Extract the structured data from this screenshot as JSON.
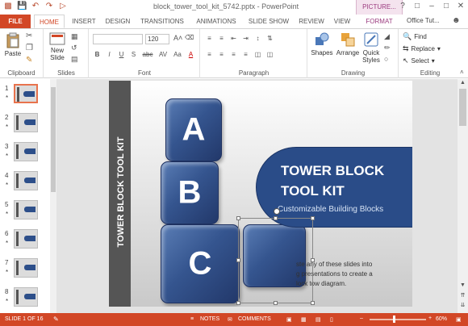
{
  "app": {
    "title": "block_tower_tool_kit_5742.pptx - PowerPoint",
    "context_tab": "PICTURE...",
    "user": "Office Tut..."
  },
  "qat": {
    "icons": [
      "powerpoint-icon",
      "save-icon",
      "undo-icon",
      "redo-icon",
      "start-slideshow-icon"
    ]
  },
  "tabs": [
    "FILE",
    "HOME",
    "INSERT",
    "DESIGN",
    "TRANSITIONS",
    "ANIMATIONS",
    "SLIDE SHOW",
    "REVIEW",
    "VIEW",
    "FORMAT"
  ],
  "active_tab": "HOME",
  "ribbon": {
    "clipboard": {
      "label": "Clipboard",
      "paste": "Paste"
    },
    "slides": {
      "label": "Slides",
      "new_slide_line1": "New",
      "new_slide_line2": "Slide"
    },
    "font": {
      "label": "Font",
      "font_size": "120",
      "format_buttons": [
        "B",
        "I",
        "U",
        "S",
        "abc",
        "AV",
        "Aa",
        "A"
      ]
    },
    "paragraph": {
      "label": "Paragraph"
    },
    "drawing": {
      "label": "Drawing",
      "shapes": "Shapes",
      "arrange": "Arrange",
      "quick_styles_line1": "Quick",
      "quick_styles_line2": "Styles"
    },
    "editing": {
      "label": "Editing",
      "find": "Find",
      "replace": "Replace",
      "select": "Select"
    }
  },
  "thumbnails": [
    {
      "num": "1",
      "star": "*"
    },
    {
      "num": "2",
      "star": "*"
    },
    {
      "num": "3",
      "star": "*"
    },
    {
      "num": "4",
      "star": "*"
    },
    {
      "num": "5",
      "star": "*"
    },
    {
      "num": "6",
      "star": "*"
    },
    {
      "num": "7",
      "star": "*"
    },
    {
      "num": "8",
      "star": "*"
    }
  ],
  "slide": {
    "vertical_title": "TOWER BLOCK TOOL KIT",
    "cube_letters": [
      "A",
      "B",
      "C"
    ],
    "banner_title_line1": "TOWER BLOCK",
    "banner_title_line2": "TOOL KIT",
    "banner_subtitle": "Customizable Building Blocks",
    "body_line1": "ste any of these slides into",
    "body_line2": "g presentations to create a",
    "body_line3": "lock tow diagram."
  },
  "status": {
    "slide_info": "SLIDE 1 OF 16",
    "notes": "NOTES",
    "comments": "COMMENTS",
    "zoom": "60%",
    "zoom_fraction": 0.6
  }
}
